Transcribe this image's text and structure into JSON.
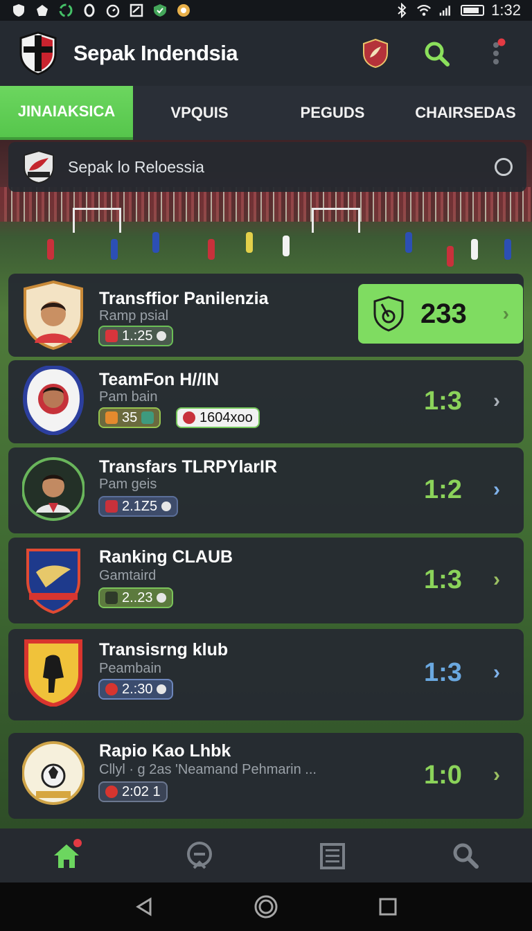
{
  "status_bar": {
    "time": "1:32",
    "icons": [
      "shield-icon",
      "pentagon-icon",
      "sync-icon",
      "circle-icon",
      "timer-icon",
      "checkbox-icon",
      "vpn-icon",
      "ball-icon"
    ],
    "right_icons": [
      "bluetooth-icon",
      "wifi-icon",
      "signal-icon",
      "battery-icon"
    ]
  },
  "app_bar": {
    "title": "Sepak Indendsia",
    "accent": "#7fdc61",
    "notification_color": "#e33a43"
  },
  "tabs": [
    {
      "label": "JINAIAKSICA",
      "active": true
    },
    {
      "label": "VPQUIS",
      "active": false
    },
    {
      "label": "PEGUDS",
      "active": false
    },
    {
      "label": "CHAIRSEDAS",
      "active": false
    }
  ],
  "search": {
    "text": "Sepak lo Reloessia"
  },
  "items": [
    {
      "title": "Transffior Panilenzia",
      "subtitle": "Ramp psial",
      "chip": "1.:25",
      "score": "233",
      "highlight": true
    },
    {
      "title": "TeamFon H//IN",
      "subtitle": "Pam bain",
      "chip": "35",
      "chip2": "1604xoo",
      "score": "1:3",
      "score_color": "#8bd35a"
    },
    {
      "title": "Transfars  TLRPYlarIR",
      "subtitle": "Pam geis",
      "chip": "2.1Z5",
      "score": "1:2",
      "score_color": "#8bd35a"
    },
    {
      "title": "Ranking CLAUB",
      "subtitle": "Gamtaird",
      "chip": "2..23",
      "score": "1:3",
      "score_color": "#8bd35a"
    },
    {
      "title": "Transisrng klub",
      "subtitle": "Peambain",
      "chip": "2.:30",
      "score": "1:3",
      "score_color": "#6aa8e0"
    },
    {
      "title": "Rapio Kao Lhbk",
      "subtitle": "Cllyl · g 2as  'Neamand Pehmarin ...",
      "chip": "2:02  1",
      "score": "1:0",
      "score_color": "#8bd35a"
    }
  ],
  "bottom_nav": [
    "home-icon",
    "match-icon",
    "news-icon",
    "search-icon"
  ]
}
